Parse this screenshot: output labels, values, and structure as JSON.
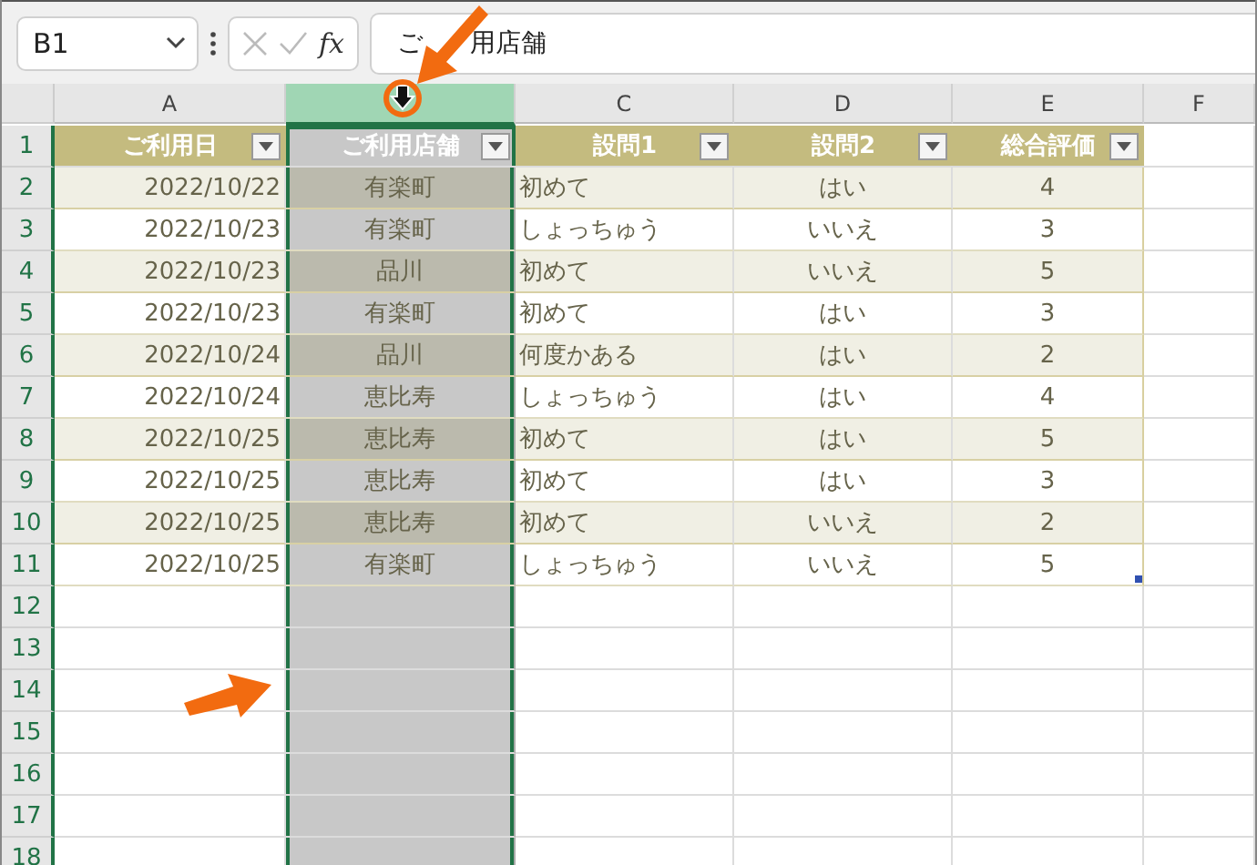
{
  "name_box": {
    "value": "B1"
  },
  "formula_bar": {
    "function_label": "fx",
    "visible_parts": [
      "ご",
      "用店舗"
    ]
  },
  "columns": [
    {
      "label": "A",
      "selected": false
    },
    {
      "selected": true
    },
    {
      "label": "C",
      "selected": false
    },
    {
      "label": "D",
      "selected": false
    },
    {
      "label": "E",
      "selected": false
    },
    {
      "label": "F",
      "selected": false
    }
  ],
  "row_numbers": [
    "1",
    "2",
    "3",
    "4",
    "5",
    "6",
    "7",
    "8",
    "9",
    "10",
    "11",
    "12",
    "13",
    "14",
    "15",
    "16",
    "17",
    "18"
  ],
  "table": {
    "headers": [
      "ご利用日",
      "ご利用店舗",
      "設問1",
      "設問2",
      "総合評価"
    ],
    "rows": [
      [
        "2022/10/22",
        "有楽町",
        "初めて",
        "はい",
        "4"
      ],
      [
        "2022/10/23",
        "有楽町",
        "しょっちゅう",
        "いいえ",
        "3"
      ],
      [
        "2022/10/23",
        "品川",
        "初めて",
        "いいえ",
        "5"
      ],
      [
        "2022/10/23",
        "有楽町",
        "初めて",
        "はい",
        "3"
      ],
      [
        "2022/10/24",
        "品川",
        "何度かある",
        "はい",
        "2"
      ],
      [
        "2022/10/24",
        "恵比寿",
        "しょっちゅう",
        "はい",
        "4"
      ],
      [
        "2022/10/25",
        "恵比寿",
        "初めて",
        "はい",
        "5"
      ],
      [
        "2022/10/25",
        "恵比寿",
        "初めて",
        "はい",
        "3"
      ],
      [
        "2022/10/25",
        "恵比寿",
        "初めて",
        "いいえ",
        "2"
      ],
      [
        "2022/10/25",
        "有楽町",
        "しょっちゅう",
        "いいえ",
        "5"
      ]
    ]
  }
}
